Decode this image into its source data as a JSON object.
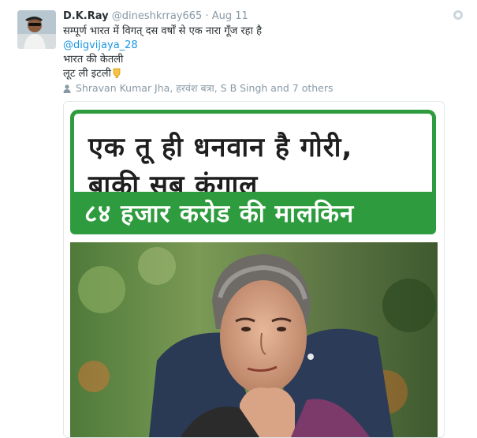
{
  "tweet": {
    "display_name": "D.K.Ray",
    "handle": "@dineshkrray665",
    "separator": "·",
    "date": "Aug 11",
    "text_lines": [
      "सम्पूर्ण भारत में विगत् दस वर्षों से एक नारा गूँज रहा है",
      "@digvijaya_28",
      "भारत की केतली",
      "लूट ली इटली"
    ],
    "emoji": "pointing-down-hand",
    "liked_by": "Shravan Kumar Jha, हरवंश बत्रा, S B Singh and 7 others"
  },
  "media": {
    "headline_line1": "एक तू ही धनवान है गोरी,",
    "headline_line2": "बाकी सब कंगाल",
    "banner_text": "८४ हजार करोड की मालकिन"
  },
  "colors": {
    "banner_green": "#2e9c3e",
    "link_blue": "#1b95e0",
    "meta_gray": "#8899a6"
  }
}
